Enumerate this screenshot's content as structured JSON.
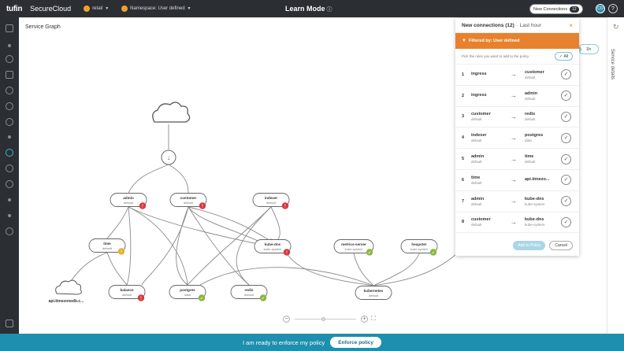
{
  "topbar": {
    "logo": "tufin",
    "product": "SecureCloud",
    "cluster": "retail",
    "namespace": "Namespace: User defined",
    "mode_title": "Learn Mode",
    "new_connections_label": "New Connections",
    "new_connections_count": "12",
    "avatar_initials": "CO",
    "help": "?"
  },
  "canvas": {
    "title": "Service Graph",
    "time_button": "1h",
    "right_strip_label": "Service details"
  },
  "graph": {
    "nodes": {
      "admin": {
        "name": "admin",
        "ns": "default",
        "status": "!"
      },
      "customer": {
        "name": "customer",
        "ns": "default",
        "status": "!"
      },
      "indexer": {
        "name": "indexer",
        "ns": "default",
        "status": "!"
      },
      "time": {
        "name": "time",
        "ns": "default",
        "status": "!"
      },
      "kubedns": {
        "name": "kube-dns",
        "ns": "kube-system",
        "status": "!"
      },
      "metrics": {
        "name": "metrics-server",
        "ns": "kube-system",
        "status": "✓"
      },
      "heapster": {
        "name": "heapster",
        "ns": "kube-system",
        "status": "✓"
      },
      "balance": {
        "name": "balance",
        "ns": "default",
        "status": "!"
      },
      "postgres": {
        "name": "postgres",
        "ns": "data",
        "status": "✓"
      },
      "redis": {
        "name": "redis",
        "ns": "default",
        "status": "✓"
      },
      "kubernetes": {
        "name": "kubernetes",
        "ns": "default"
      }
    },
    "external_label": "api.timezonedb.c..."
  },
  "panel": {
    "title": "New connections (12)",
    "subtitle": "· Last hour",
    "close": "×",
    "filter": "Filtered by: User defined",
    "pick_text": "Pick the rules you want to add to the policy",
    "all_button": "All",
    "rows": [
      {
        "num": "1",
        "src": "ingress",
        "src_ns": "",
        "dst": "customer",
        "dst_ns": "default"
      },
      {
        "num": "2",
        "src": "ingress",
        "src_ns": "",
        "dst": "admin",
        "dst_ns": "default"
      },
      {
        "num": "3",
        "src": "customer",
        "src_ns": "default",
        "dst": "redis",
        "dst_ns": "default"
      },
      {
        "num": "4",
        "src": "indexer",
        "src_ns": "default",
        "dst": "postgres",
        "dst_ns": "data"
      },
      {
        "num": "5",
        "src": "admin",
        "src_ns": "default",
        "dst": "time",
        "dst_ns": "default"
      },
      {
        "num": "6",
        "src": "time",
        "src_ns": "default",
        "dst": "api.timezo...",
        "dst_ns": ""
      },
      {
        "num": "7",
        "src": "admin",
        "src_ns": "default",
        "dst": "kube-dns",
        "dst_ns": "kube-system"
      },
      {
        "num": "8",
        "src": "customer",
        "src_ns": "default",
        "dst": "kube-dns",
        "dst_ns": "kube-system"
      }
    ],
    "add_button": "Add to Policy",
    "cancel_button": "Cancel"
  },
  "bottombar": {
    "text": "I am ready to enforce my policy",
    "button": "Enforce policy"
  },
  "colors": {
    "accent": "#1e8fae",
    "orange": "#e8812e",
    "status_red": "#d9363e",
    "status_green": "#8ab63c",
    "status_yellow": "#e6b02e"
  }
}
